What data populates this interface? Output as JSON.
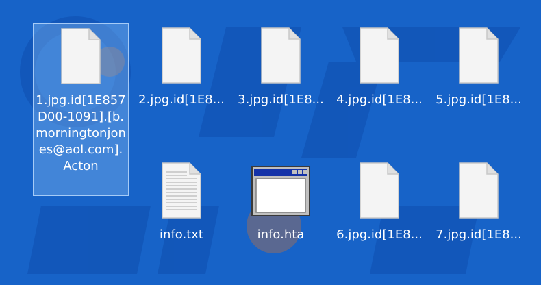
{
  "colors": {
    "desktop_bg": "#1763c8",
    "selection_bg": "#6aa7e6",
    "label_text": "#ffffff",
    "file_icon": "#f4f4f4",
    "hta_titlebar": "#1432a8"
  },
  "files": [
    {
      "label": "1.jpg.id[1E857D00-1091].[b.morningtonjones@aol.com].Acton",
      "icon": "blank-file-icon",
      "selected": true
    },
    {
      "label": "2.jpg.id[1E8...",
      "icon": "blank-file-icon"
    },
    {
      "label": "3.jpg.id[1E8...",
      "icon": "blank-file-icon"
    },
    {
      "label": "4.jpg.id[1E8...",
      "icon": "blank-file-icon"
    },
    {
      "label": "5.jpg.id[1E8...",
      "icon": "blank-file-icon"
    },
    {
      "label": "info.txt",
      "icon": "text-file-icon"
    },
    {
      "label": "info.hta",
      "icon": "hta-window-icon"
    },
    {
      "label": "6.jpg.id[1E8...",
      "icon": "blank-file-icon"
    },
    {
      "label": "7.jpg.id[1E8...",
      "icon": "blank-file-icon"
    }
  ]
}
